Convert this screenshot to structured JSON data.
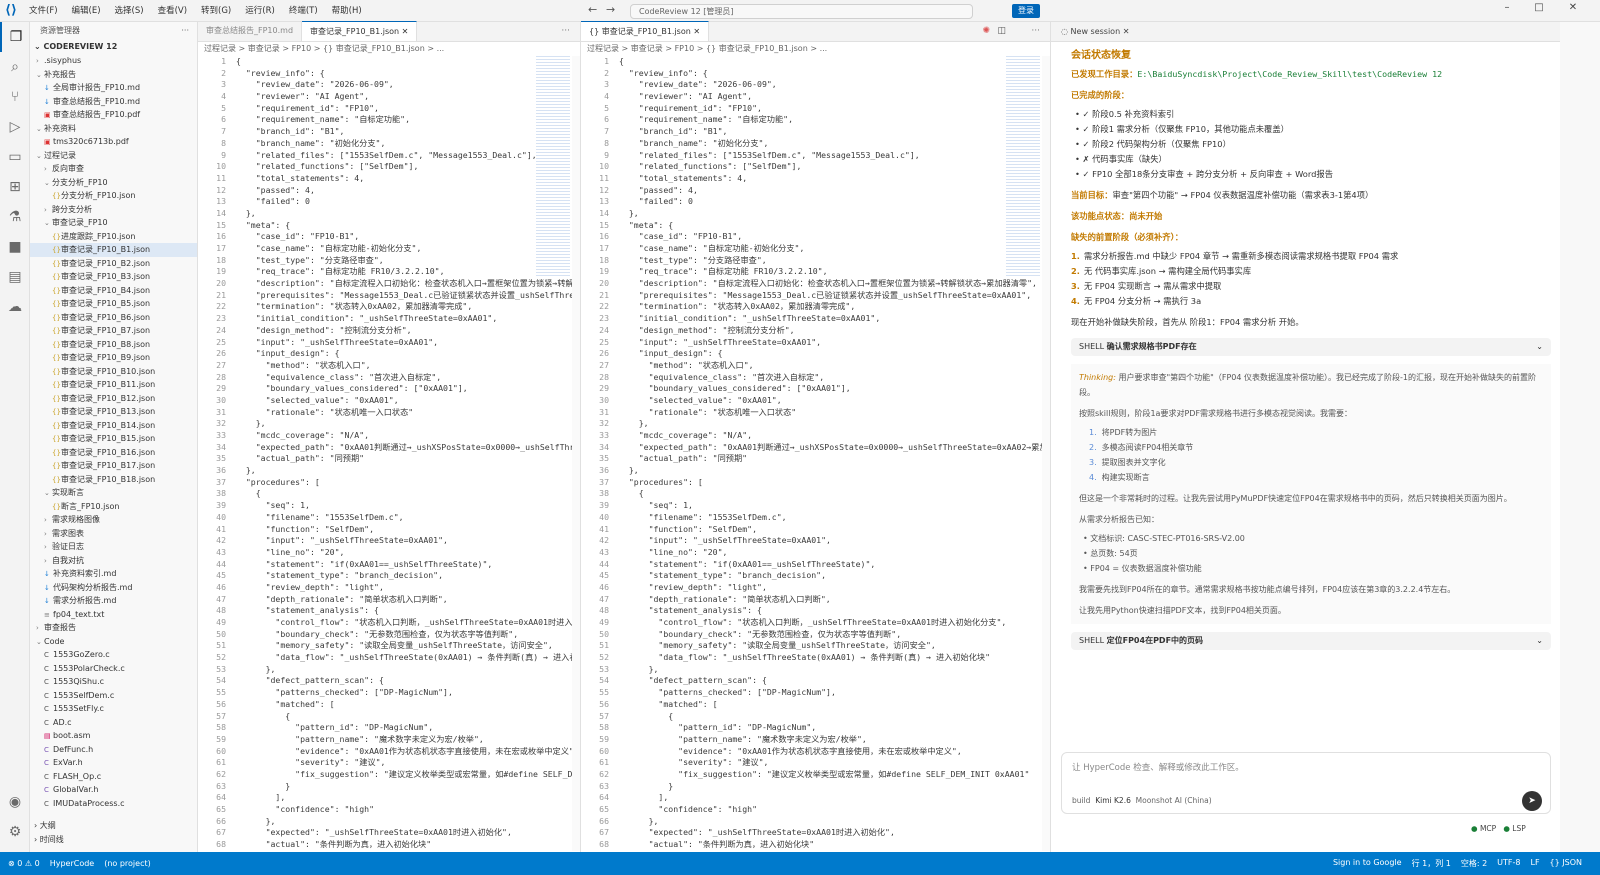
{
  "menu": [
    "文件(F)",
    "编辑(E)",
    "选择(S)",
    "查看(V)",
    "转到(G)",
    "运行(R)",
    "终端(T)",
    "帮助(H)"
  ],
  "command_center": "CodeReview 12 [管理员]",
  "login_label": "登录",
  "sidebar": {
    "header": "资源管理器",
    "root": "CODEREVIEW 12",
    "rows": [
      {
        "depth": 0,
        "chev": ">",
        "label": ".sisyphus",
        "type": "folder"
      },
      {
        "depth": 0,
        "chev": "v",
        "label": "补充报告",
        "type": "folder"
      },
      {
        "depth": 1,
        "label": "全局审计报告_FP10.md",
        "type": "md"
      },
      {
        "depth": 1,
        "label": "审查总结报告_FP10.md",
        "type": "md"
      },
      {
        "depth": 1,
        "label": "审查总结报告_FP10.pdf",
        "type": "pdf"
      },
      {
        "depth": 0,
        "chev": "v",
        "label": "补充资料",
        "type": "folder"
      },
      {
        "depth": 1,
        "label": "tms320c6713b.pdf",
        "type": "pdf"
      },
      {
        "depth": 0,
        "chev": "v",
        "label": "过程记录",
        "type": "folder"
      },
      {
        "depth": 1,
        "chev": ">",
        "label": "反向审查",
        "type": "folder"
      },
      {
        "depth": 1,
        "chev": "v",
        "label": "分支分析_FP10",
        "type": "folder"
      },
      {
        "depth": 2,
        "label": "分支分析_FP10.json",
        "type": "json"
      },
      {
        "depth": 1,
        "chev": ">",
        "label": "跨分支分析",
        "type": "folder"
      },
      {
        "depth": 1,
        "chev": "v",
        "label": "审查记录_FP10",
        "type": "folder"
      },
      {
        "depth": 2,
        "label": "进度跟踪_FP10.json",
        "type": "json"
      },
      {
        "depth": 2,
        "label": "审查记录_FP10_B1.json",
        "type": "json",
        "sel": true
      },
      {
        "depth": 2,
        "label": "审查记录_FP10_B2.json",
        "type": "json"
      },
      {
        "depth": 2,
        "label": "审查记录_FP10_B3.json",
        "type": "json"
      },
      {
        "depth": 2,
        "label": "审查记录_FP10_B4.json",
        "type": "json"
      },
      {
        "depth": 2,
        "label": "审查记录_FP10_B5.json",
        "type": "json"
      },
      {
        "depth": 2,
        "label": "审查记录_FP10_B6.json",
        "type": "json"
      },
      {
        "depth": 2,
        "label": "审查记录_FP10_B7.json",
        "type": "json"
      },
      {
        "depth": 2,
        "label": "审查记录_FP10_B8.json",
        "type": "json"
      },
      {
        "depth": 2,
        "label": "审查记录_FP10_B9.json",
        "type": "json"
      },
      {
        "depth": 2,
        "label": "审查记录_FP10_B10.json",
        "type": "json"
      },
      {
        "depth": 2,
        "label": "审查记录_FP10_B11.json",
        "type": "json"
      },
      {
        "depth": 2,
        "label": "审查记录_FP10_B12.json",
        "type": "json"
      },
      {
        "depth": 2,
        "label": "审查记录_FP10_B13.json",
        "type": "json"
      },
      {
        "depth": 2,
        "label": "审查记录_FP10_B14.json",
        "type": "json"
      },
      {
        "depth": 2,
        "label": "审查记录_FP10_B15.json",
        "type": "json"
      },
      {
        "depth": 2,
        "label": "审查记录_FP10_B16.json",
        "type": "json"
      },
      {
        "depth": 2,
        "label": "审查记录_FP10_B17.json",
        "type": "json"
      },
      {
        "depth": 2,
        "label": "审查记录_FP10_B18.json",
        "type": "json"
      },
      {
        "depth": 1,
        "chev": "v",
        "label": "实现断言",
        "type": "folder"
      },
      {
        "depth": 2,
        "label": "断言_FP10.json",
        "type": "json"
      },
      {
        "depth": 1,
        "chev": ">",
        "label": "需求规格图像",
        "type": "folder"
      },
      {
        "depth": 1,
        "chev": ">",
        "label": "需求图表",
        "type": "folder"
      },
      {
        "depth": 1,
        "chev": ">",
        "label": "验证日志",
        "type": "folder"
      },
      {
        "depth": 1,
        "chev": ">",
        "label": "自我对抗",
        "type": "folder"
      },
      {
        "depth": 1,
        "label": "补充资料索引.md",
        "type": "md"
      },
      {
        "depth": 1,
        "label": "代码架构分析报告.md",
        "type": "md"
      },
      {
        "depth": 1,
        "label": "需求分析报告.md",
        "type": "md"
      },
      {
        "depth": 1,
        "label": "fp04_text.txt",
        "type": "txt"
      },
      {
        "depth": 0,
        "chev": ">",
        "label": "审查报告",
        "type": "folder"
      },
      {
        "depth": 0,
        "chev": "v",
        "label": "Code",
        "type": "folder"
      },
      {
        "depth": 1,
        "label": "1553GoZero.c",
        "type": "c"
      },
      {
        "depth": 1,
        "label": "1553PolarCheck.c",
        "type": "c"
      },
      {
        "depth": 1,
        "label": "1553QiShu.c",
        "type": "c"
      },
      {
        "depth": 1,
        "label": "1553SelfDem.c",
        "type": "c"
      },
      {
        "depth": 1,
        "label": "1553SetFly.c",
        "type": "c"
      },
      {
        "depth": 1,
        "label": "AD.c",
        "type": "c"
      },
      {
        "depth": 1,
        "label": "boot.asm",
        "type": "asm"
      },
      {
        "depth": 1,
        "label": "DefFunc.h",
        "type": "h"
      },
      {
        "depth": 1,
        "label": "ExVar.h",
        "type": "h"
      },
      {
        "depth": 1,
        "label": "FLASH_Op.c",
        "type": "c"
      },
      {
        "depth": 1,
        "label": "GlobalVar.h",
        "type": "h"
      },
      {
        "depth": 1,
        "label": "IMUDataProcess.c",
        "type": "c"
      }
    ],
    "bottom": [
      "大纲",
      "时间线"
    ]
  },
  "editor1": {
    "tabs": [
      {
        "label": "审查总结报告_FP10.md",
        "active": false
      },
      {
        "label": "审查记录_FP10_B1.json",
        "active": true
      }
    ],
    "breadcrumb": "过程记录 > 审查记录 > FP10 > {} 审查记录_FP10_B1.json > ..."
  },
  "editor2": {
    "tabs": [
      {
        "label": "{} 审查记录_FP10_B1.json",
        "active": true
      }
    ],
    "breadcrumb": "过程记录 > 审查记录 > FP10 > {} 审查记录_FP10_B1.json > ..."
  },
  "code_lines": [
    "{",
    "  \"review_info\": {",
    "    \"review_date\": \"2026-06-09\",",
    "    \"reviewer\": \"AI Agent\",",
    "    \"requirement_id\": \"FP10\",",
    "    \"requirement_name\": \"自标定功能\",",
    "    \"branch_id\": \"B1\",",
    "    \"branch_name\": \"初始化分支\",",
    "    \"related_files\": [\"1553SelfDem.c\", \"Message1553_Deal.c\"],",
    "    \"related_functions\": [\"SelfDem\"],",
    "    \"total_statements\": 4,",
    "    \"passed\": 4,",
    "    \"failed\": 0",
    "  },",
    "  \"meta\": {",
    "    \"case_id\": \"FP10-B1\",",
    "    \"case_name\": \"自标定功能-初始化分支\",",
    "    \"test_type\": \"分支路径审查\",",
    "    \"req_trace\": \"自标定功能 FR10/3.2.2.10\",",
    "    \"description\": \"自标定流程入口初始化：检查状态机入口→置框架位置为锁紧→转解锁状态→累加器清零\",",
    "    \"prerequisites\": \"Message1553_Deal.c已验证锁紧状态并设置_ushSelfThreeState=0xAA01\",",
    "    \"termination\": \"状态转入0xAA02，累加器清零完成\",",
    "    \"initial_condition\": \"_ushSelfThreeState=0xAA01\",",
    "    \"design_method\": \"控制流分支分析\",",
    "    \"input\": \"_ushSelfThreeState=0xAA01\",",
    "    \"input_design\": {",
    "      \"method\": \"状态机入口\",",
    "      \"equivalence_class\": \"首次进入自标定\",",
    "      \"boundary_values_considered\": [\"0xAA01\"],",
    "      \"selected_value\": \"0xAA01\",",
    "      \"rationale\": \"状态机唯一入口状态\"",
    "    },",
    "    \"mcdc_coverage\": \"N/A\",",
    "    \"expected_path\": \"0xAA01判断通过→_ushXSPosState=0x0000→_ushSelfThreeState=0xAA02→累加器清零\",",
    "    \"actual_path\": \"同预期\"",
    "  },",
    "  \"procedures\": [",
    "    {",
    "      \"seq\": 1,",
    "      \"filename\": \"1553SelfDem.c\",",
    "      \"function\": \"SelfDem\",",
    "      \"input\": \"_ushSelfThreeState=0xAA01\",",
    "      \"line_no\": \"20\",",
    "      \"statement\": \"if(0xAA01==_ushSelfThreeState)\",",
    "      \"statement_type\": \"branch_decision\",",
    "      \"review_depth\": \"light\",",
    "      \"depth_rationale\": \"简单状态机入口判断\",",
    "      \"statement_analysis\": {",
    "        \"control_flow\": \"状态机入口判断，_ushSelfThreeState=0xAA01时进入初始化分支\",",
    "        \"boundary_check\": \"无参数范围检查，仅为状态字等值判断\",",
    "        \"memory_safety\": \"读取全局变量_ushSelfThreeState，访问安全\",",
    "        \"data_flow\": \"_ushSelfThreeState(0xAA01) → 条件判断(真) → 进入初始化块\"",
    "      },",
    "      \"defect_pattern_scan\": {",
    "        \"patterns_checked\": [\"DP-MagicNum\"],",
    "        \"matched\": [",
    "          {",
    "            \"pattern_id\": \"DP-MagicNum\",",
    "            \"pattern_name\": \"魔术数字未定义为宏/枚举\",",
    "            \"evidence\": \"0xAA01作为状态机状态字直接使用，未在宏或枚举中定义\",",
    "            \"severity\": \"建议\",",
    "            \"fix_suggestion\": \"建议定义枚举类型或宏常量，如#define SELF_DEM_INIT 0xAA01\"",
    "          }",
    "        ],",
    "        \"confidence\": \"high\"",
    "      },",
    "      \"expected\": \"_ushSelfThreeState=0xAA01时进入初始化\",",
    "      \"actual\": \"条件判断为真，进入初始化块\""
  ],
  "chat": {
    "tab_label": "New session",
    "title": "会话状态恢复",
    "workdir_label": "已发现工作目录：",
    "workdir_path": "E:\\BaiduSyncdisk\\Project\\Code_Review_Skill\\test\\CodeReview 12",
    "done_title": "已完成的阶段：",
    "done_items": [
      "✓ 阶段0.5 补充资料索引",
      "✓ 阶段1 需求分析（仅聚焦 FP10，其他功能点未覆盖）",
      "✓ 阶段2 代码架构分析（仅聚焦 FP10）",
      "✗ 代码事实库（缺失）",
      "✓ FP10 全部18条分支审查 + 跨分支分析 + 反向审查 + Word报告"
    ],
    "goal_label": "当前目标：",
    "goal_text": "审查\"第四个功能\" → FP04 仪表数据温度补偿功能（需求表3-1第4项）",
    "status_label": "该功能点状态：",
    "status_value": "尚未开始",
    "missing_title": "缺失的前置阶段（必须补齐）：",
    "missing_items": [
      "需求分析报告.md 中缺少 FP04 章节 → 需重新多模态阅读需求规格书提取 FP04 需求",
      "无 代码事实库.json → 需构建全局代码事实库",
      "无 FP04 实现断言 → 需从需求中提取",
      "无 FP04 分支分析 → 需执行 3a"
    ],
    "start_text": "现在开始补做缺失阶段，首先从 阶段1：FP04 需求分析 开始。",
    "shell1": "确认需求规格书PDF存在",
    "think_label": "Thinking:",
    "think_text": "用户要求审查\"第四个功能\"（FP04 仪表数据温度补偿功能）。我已经完成了阶段-1的汇报，现在开始补做缺失的前置阶段。",
    "think_p2": "按照skill规则，阶段1a要求对PDF需求规格书进行多模态视觉阅读。我需要：",
    "think_list": [
      "将PDF转为图片",
      "多模态阅读FP04相关章节",
      "提取图表并文字化",
      "构建实现断言"
    ],
    "think_p3": "但这是一个非常耗时的过程。让我先尝试用PyMuPDF快速定位FP04在需求规格书中的页码，然后只转换相关页面为图片。",
    "think_p4": "从需求分析报告已知：",
    "think_bullets": [
      "文档标识: CASC-STEC-PT016-SRS-V2.00",
      "总页数: 54页",
      "FP04 = 仪表数据温度补偿功能"
    ],
    "think_p5": "我需要先找到FP04所在的章节。通常需求规格书按功能点编号排列，FP04应该在第3章的3.2.2.4节左右。",
    "think_p6": "让我先用Python快速扫描PDF文本，找到FP04相关页面。",
    "shell2": "定位FP04在PDF中的页码",
    "input_placeholder": "让 HyperCode 检查、解释或修改此工作区。",
    "model_mode": "build",
    "model_name": "Kimi K2.6",
    "model_provider": "Moonshot AI (China)",
    "footer": [
      "MCP",
      "LSP"
    ]
  },
  "statusbar": {
    "left": [
      "⊗ 0 ⚠ 0",
      "HyperCode",
      "(no project)"
    ],
    "right": [
      "Sign in to Google",
      "行 1，列 1",
      "空格: 2",
      "UTF-8",
      "LF",
      "{} JSON"
    ]
  }
}
